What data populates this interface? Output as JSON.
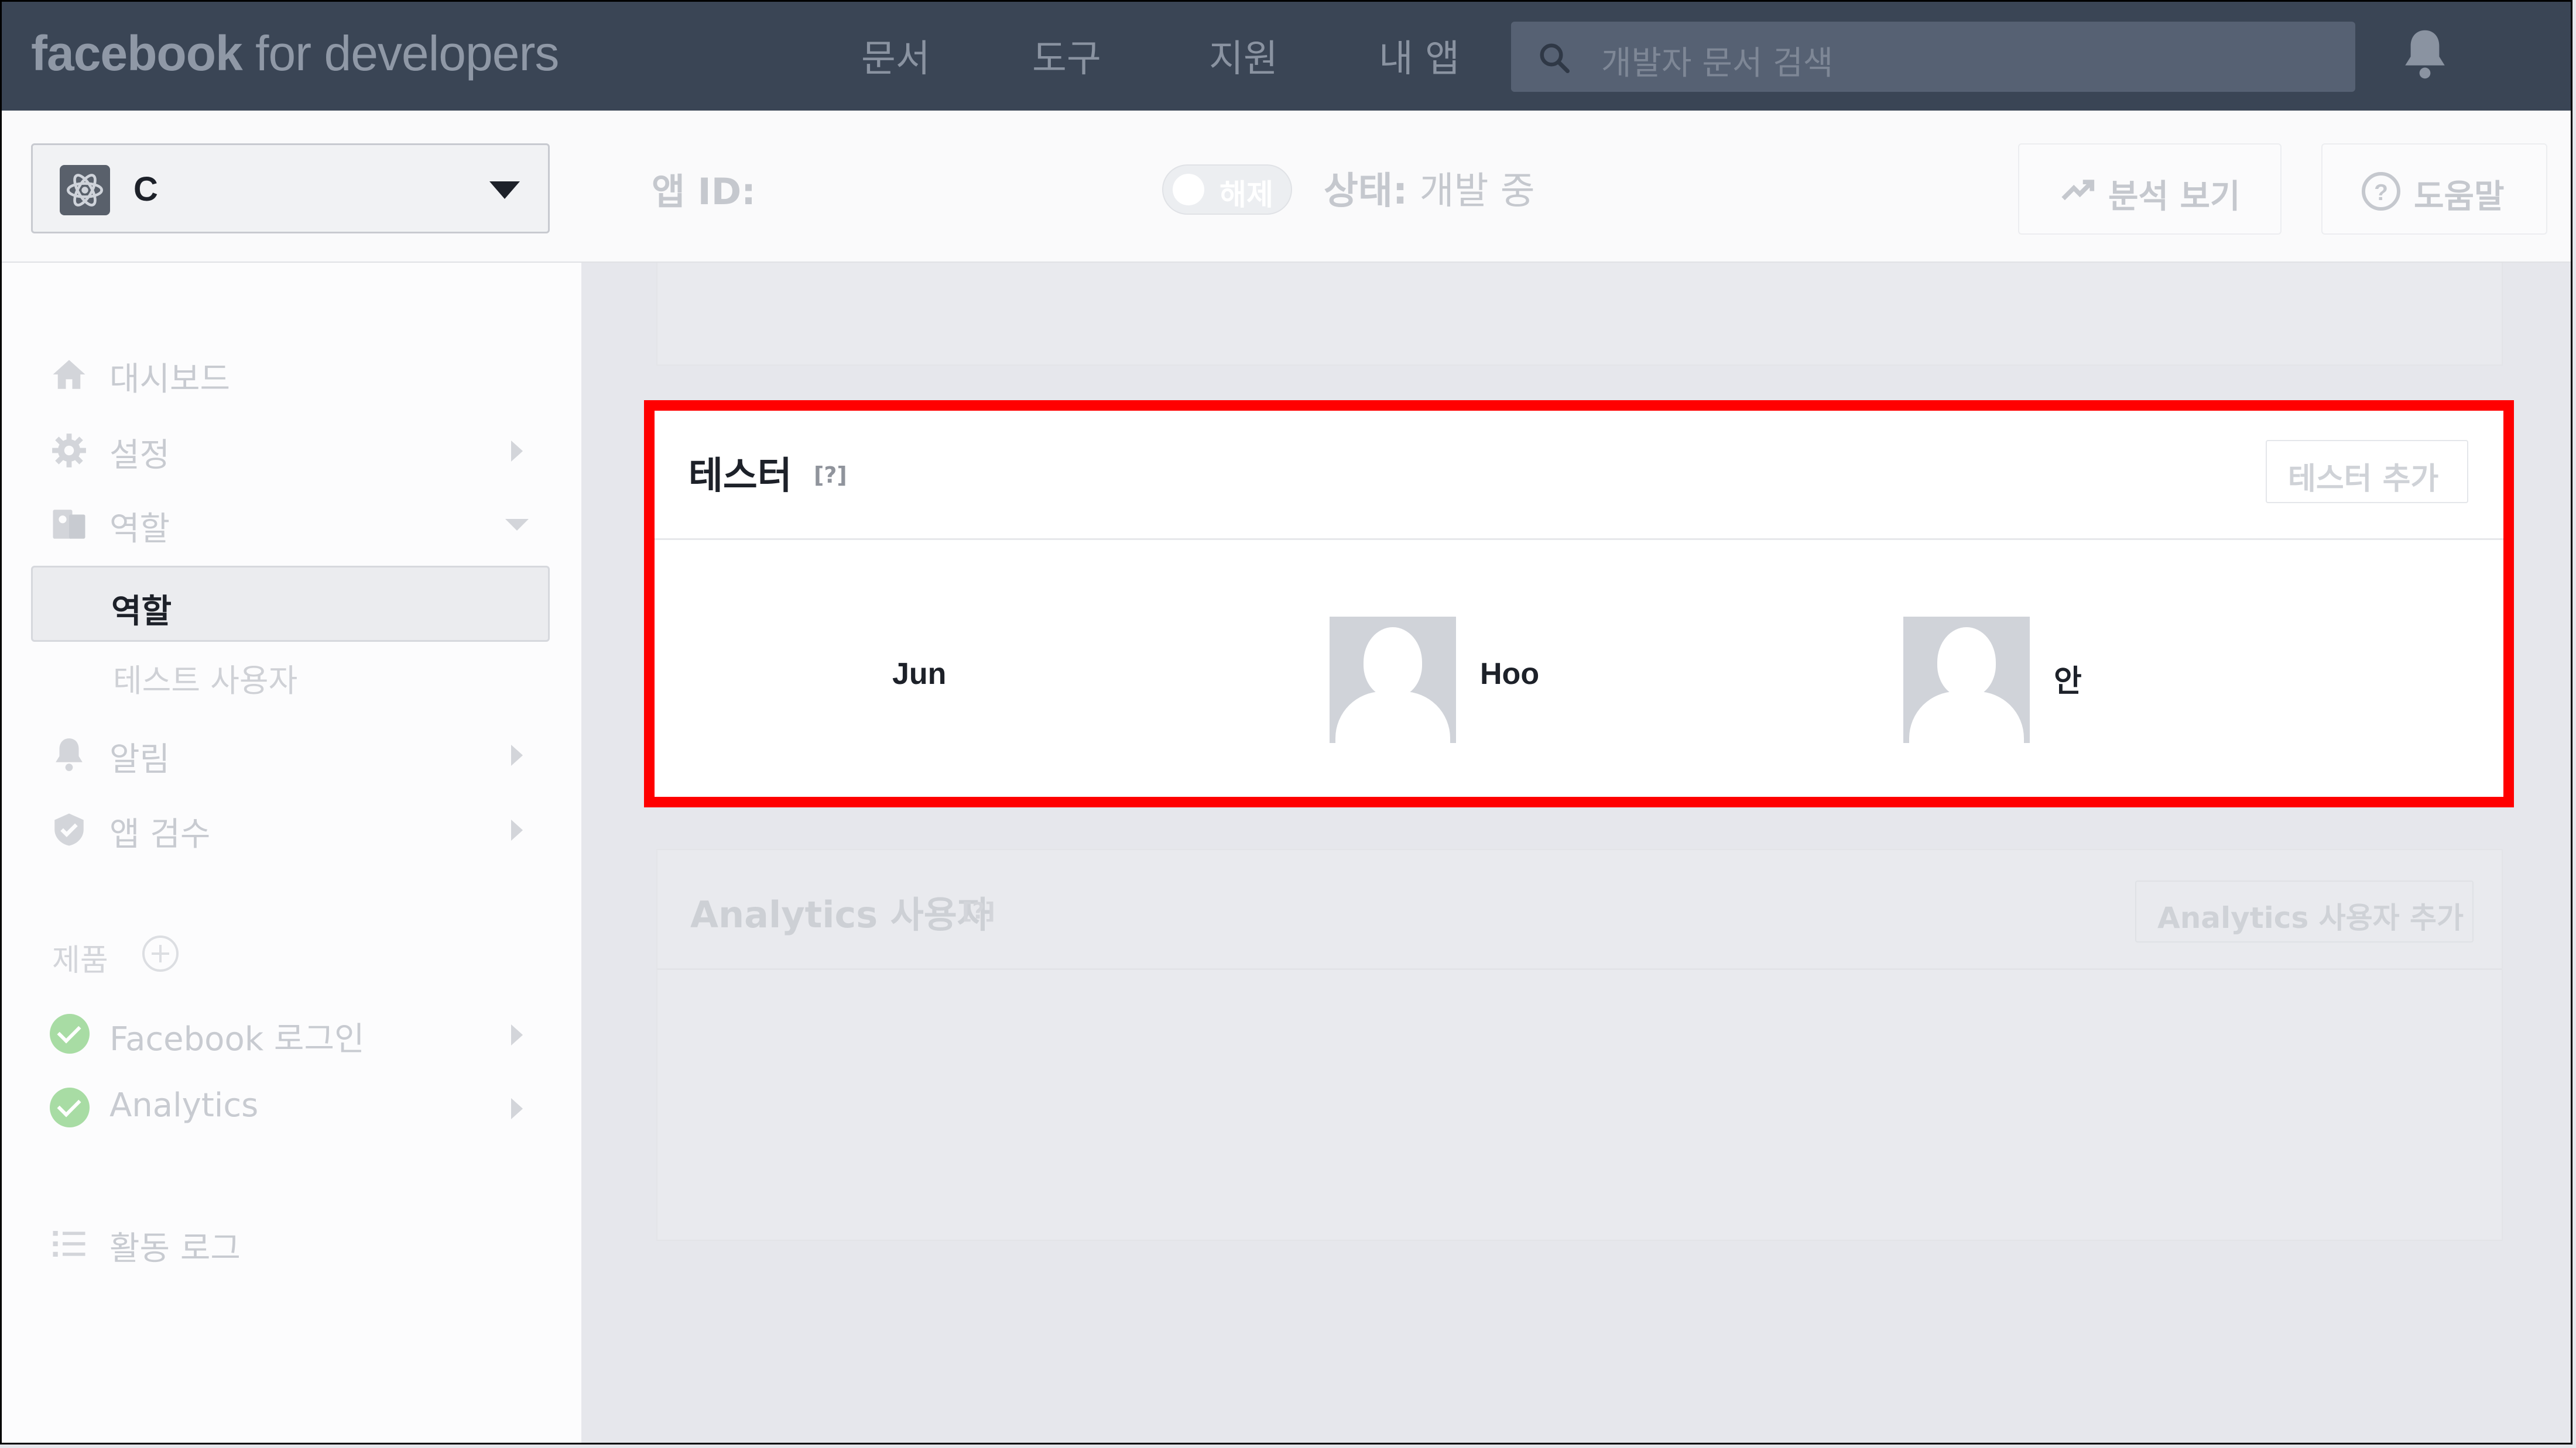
{
  "topbar": {
    "brand_bold": "facebook",
    "brand_rest": " for developers",
    "nav": [
      "문서",
      "도구",
      "지원",
      "내 앱"
    ],
    "search_placeholder": "개발자 문서 검색"
  },
  "header": {
    "app_name": "C",
    "app_id_label": "앱 ID:",
    "toggle_label": "해제",
    "status_label": "상태:",
    "status_value": " 개발 중",
    "analytics_button": "분석 보기",
    "help_button": "도움말"
  },
  "sidebar": {
    "items": [
      {
        "label": "대시보드",
        "icon": "home-icon"
      },
      {
        "label": "설정",
        "icon": "gear-icon"
      },
      {
        "label": "역할",
        "icon": "roles-icon"
      },
      {
        "label": "역할"
      },
      {
        "label": "테스트 사용자"
      },
      {
        "label": "알림",
        "icon": "bell-icon"
      },
      {
        "label": "앱 검수",
        "icon": "shield-icon"
      }
    ],
    "products_label": "제품",
    "products": [
      {
        "label": "Facebook 로그인",
        "icon": "check-circle-icon"
      },
      {
        "label": "Analytics",
        "icon": "check-circle-icon"
      }
    ],
    "activity_log": "활동 로그"
  },
  "testers": {
    "title": "테스터",
    "help": "[?]",
    "add_button": "테스터 추가",
    "people": [
      {
        "name": "Jun",
        "has_avatar": false
      },
      {
        "name": "Hoo",
        "has_avatar": true
      },
      {
        "name": "안",
        "has_avatar": true
      }
    ]
  },
  "analytics_users": {
    "title": "Analytics 사용자",
    "help": "[?]",
    "add_button": "Analytics 사용자 추가"
  },
  "colors": {
    "topbar": "#3a4555",
    "highlight_border": "#ff0000",
    "success_green": "#a8dca4"
  }
}
